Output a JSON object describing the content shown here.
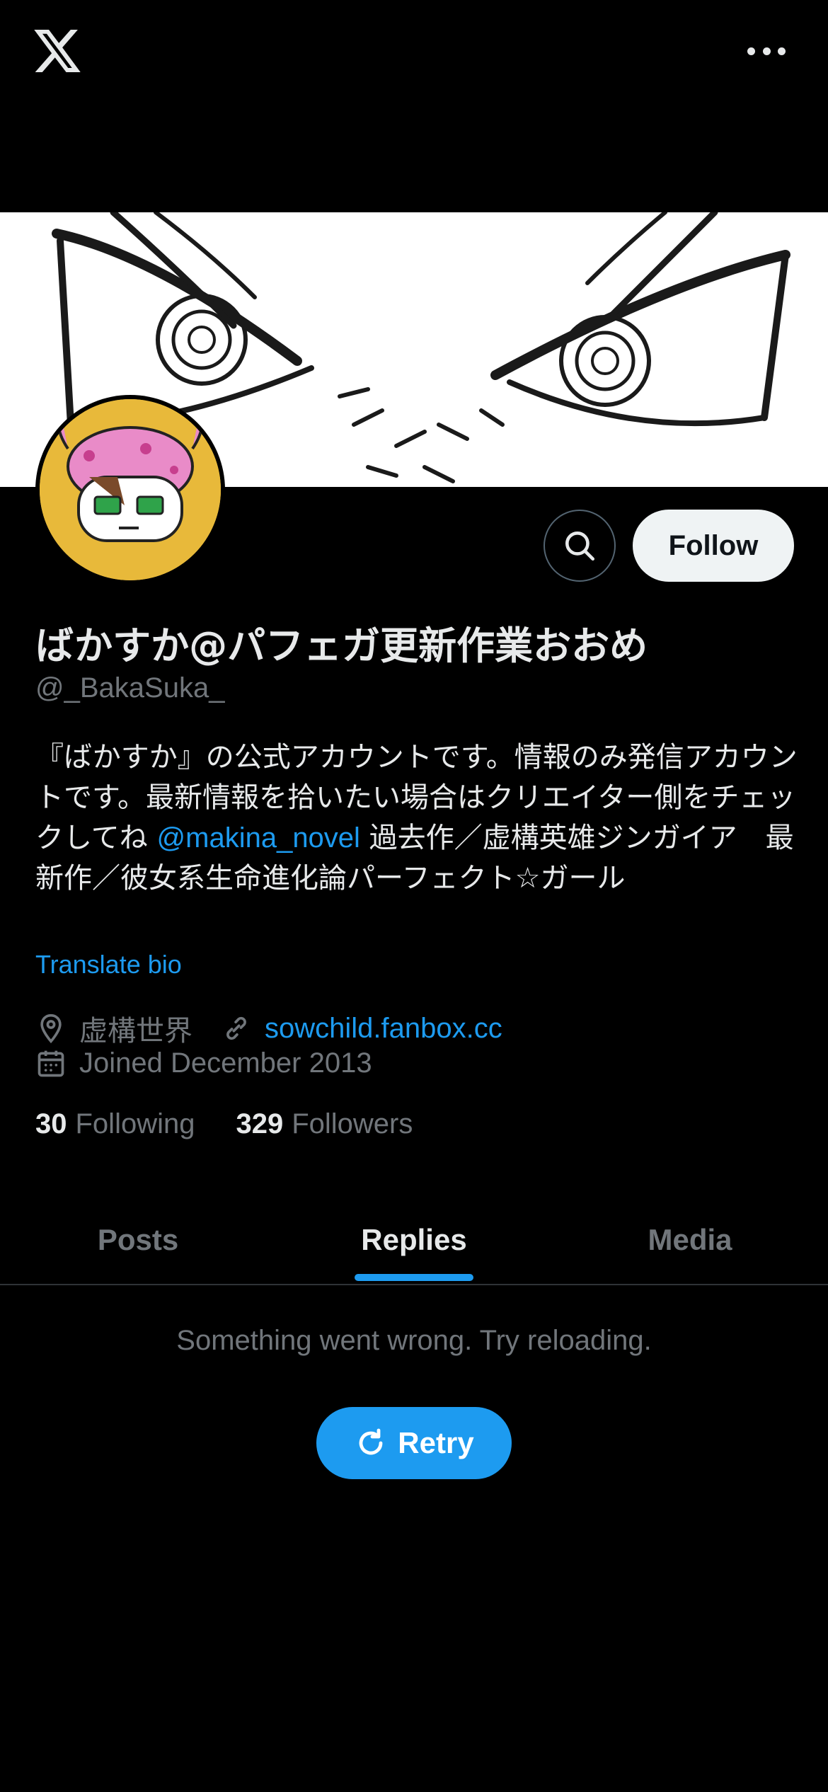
{
  "header": {
    "logo_icon": "x-logo-icon",
    "more_icon": "more-horizontal-icon"
  },
  "profile": {
    "display_name": "ばかすか@パフェガ更新作業おおめ",
    "handle": "@_BakaSuka_",
    "bio_part1": "『ばかすか』の公式アカウントです。情報のみ発信アカウントです。最新情報を拾いたい場合はクリエイター側をチェックしてね ",
    "bio_mention": "@makina_novel",
    "bio_part2": " 過去作／虚構英雄ジンガイア　最新作／彼女系生命進化論パーフェクト☆ガール",
    "translate_label": "Translate bio",
    "location": "虚構世界",
    "website": "sowchild.fanbox.cc",
    "joined": "Joined December 2013",
    "following_count": "30",
    "following_label": "Following",
    "followers_count": "329",
    "followers_label": "Followers"
  },
  "actions": {
    "search_icon": "search-icon",
    "follow_label": "Follow"
  },
  "tabs": [
    {
      "label": "Posts",
      "active": false
    },
    {
      "label": "Replies",
      "active": true
    },
    {
      "label": "Media",
      "active": false
    }
  ],
  "feed": {
    "error_message": "Something went wrong. Try reloading.",
    "retry_label": "Retry",
    "retry_icon": "refresh-icon"
  },
  "colors": {
    "accent": "#1d9bf0",
    "background": "#000000",
    "text_primary": "#e7e9ea",
    "text_secondary": "#71767b"
  }
}
